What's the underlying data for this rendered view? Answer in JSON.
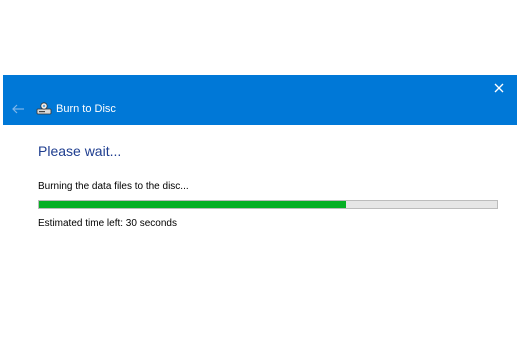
{
  "window": {
    "title": "Burn to Disc",
    "close_icon": "close-icon",
    "back_icon": "back-arrow-icon",
    "app_icon": "disc-burn-icon"
  },
  "content": {
    "heading": "Please wait...",
    "status": "Burning the data files to the disc...",
    "progress_fraction": 0.67,
    "time_left": "Estimated time left: 30 seconds"
  },
  "colors": {
    "titlebar": "#0078d7",
    "heading": "#1e3d8f",
    "progress_fill": "#06b025",
    "progress_track": "#e6e6e6"
  }
}
